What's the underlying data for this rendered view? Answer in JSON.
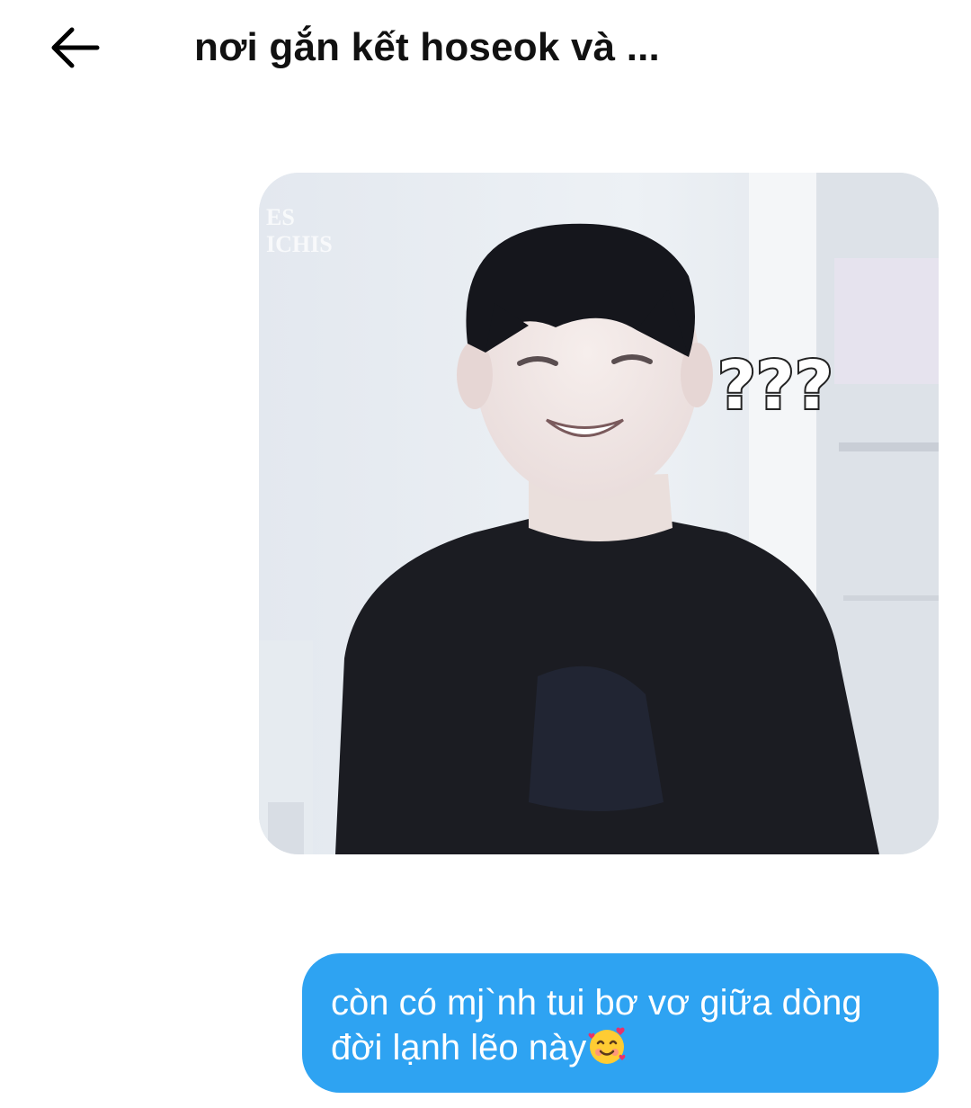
{
  "header": {
    "title": "nơi gắn kết hoseok và ...",
    "back_icon": "arrow-left-icon"
  },
  "messages": [
    {
      "type": "image",
      "overlay_text": "???",
      "watermark_text": "ES\nICHIS",
      "icon": "photo-icon"
    },
    {
      "type": "text",
      "text": "còn có mj`nh tui bơ vơ giữa dòng đời lạnh lẽo này",
      "emoji": "smiling-face-with-hearts-icon"
    }
  ],
  "colors": {
    "bubble": "#2ea3f2",
    "bubble_text": "#ffffff",
    "title": "#111111",
    "background": "#ffffff"
  }
}
